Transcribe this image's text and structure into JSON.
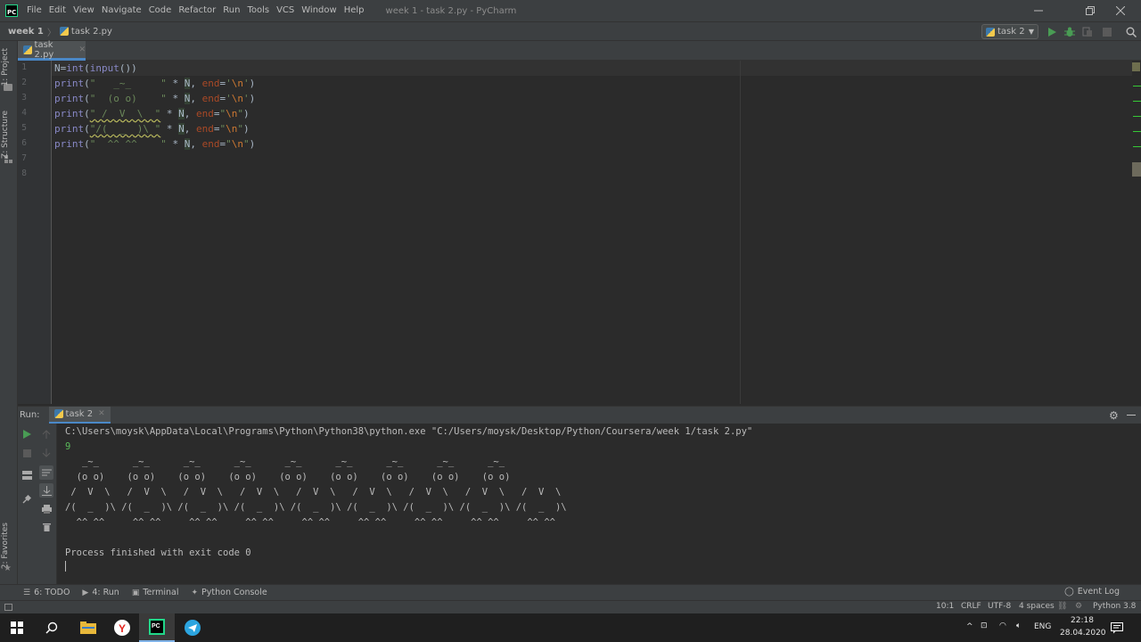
{
  "window": {
    "menu": [
      "File",
      "Edit",
      "View",
      "Navigate",
      "Code",
      "Refactor",
      "Run",
      "Tools",
      "VCS",
      "Window",
      "Help"
    ],
    "title": "week 1 - task 2.py - PyCharm",
    "logo_text": "PC"
  },
  "navbar": {
    "folder": "week 1",
    "file": "task 2.py",
    "run_config": "task 2"
  },
  "left_stripe": {
    "project": "1: Project",
    "structure": "Z: Structure",
    "favorites": "2: Favorites"
  },
  "editor": {
    "tab_label": "task 2.py",
    "line_numbers": [
      "1",
      "2",
      "3",
      "4",
      "5",
      "6",
      "7",
      "8"
    ]
  },
  "run_panel": {
    "label": "Run:",
    "tab": "task 2",
    "command": "C:\\Users\\moysk\\AppData\\Local\\Programs\\Python\\Python38\\python.exe \"C:/Users/moysk/Desktop/Python/Coursera/week 1/task 2.py\"",
    "input_echo": "9",
    "output_lines": [
      "   _~_      _~_      _~_      _~_      _~_      _~_      _~_      _~_      _~_",
      "  (o o)    (o o)    (o o)    (o o)    (o o)    (o o)    (o o)    (o o)    (o o)",
      " /  V  \\   /  V  \\   /  V  \\   /  V  \\   /  V  \\   /  V  \\   /  V  \\   /  V  \\   /  V  \\",
      "/(  _  )\\ /(  _  )\\ /(  _  )\\ /(  _  )\\ /(  _  )\\ /(  _  )\\ /(  _  )\\ /(  _  )\\ /(  _  )\\",
      "  ^^ ^^     ^^ ^^     ^^ ^^     ^^ ^^     ^^ ^^     ^^ ^^     ^^ ^^     ^^ ^^     ^^ ^^"
    ],
    "exit_message": "Process finished with exit code 0"
  },
  "bottom_tabs": {
    "todo": "6: TODO",
    "run": "4: Run",
    "terminal": "Terminal",
    "python_console": "Python Console",
    "event_log": "Event Log"
  },
  "statusbar": {
    "position": "10:1",
    "line_sep": "CRLF",
    "encoding": "UTF-8",
    "indent": "4 spaces",
    "interpreter": "Python 3.8"
  },
  "taskbar": {
    "lang": "ENG",
    "time": "22:18",
    "date": "28.04.2020"
  },
  "colors": {
    "accent": "#4a88c7",
    "run_green": "#499c54",
    "string_green": "#6a8759",
    "keyword": "#cc7832"
  }
}
